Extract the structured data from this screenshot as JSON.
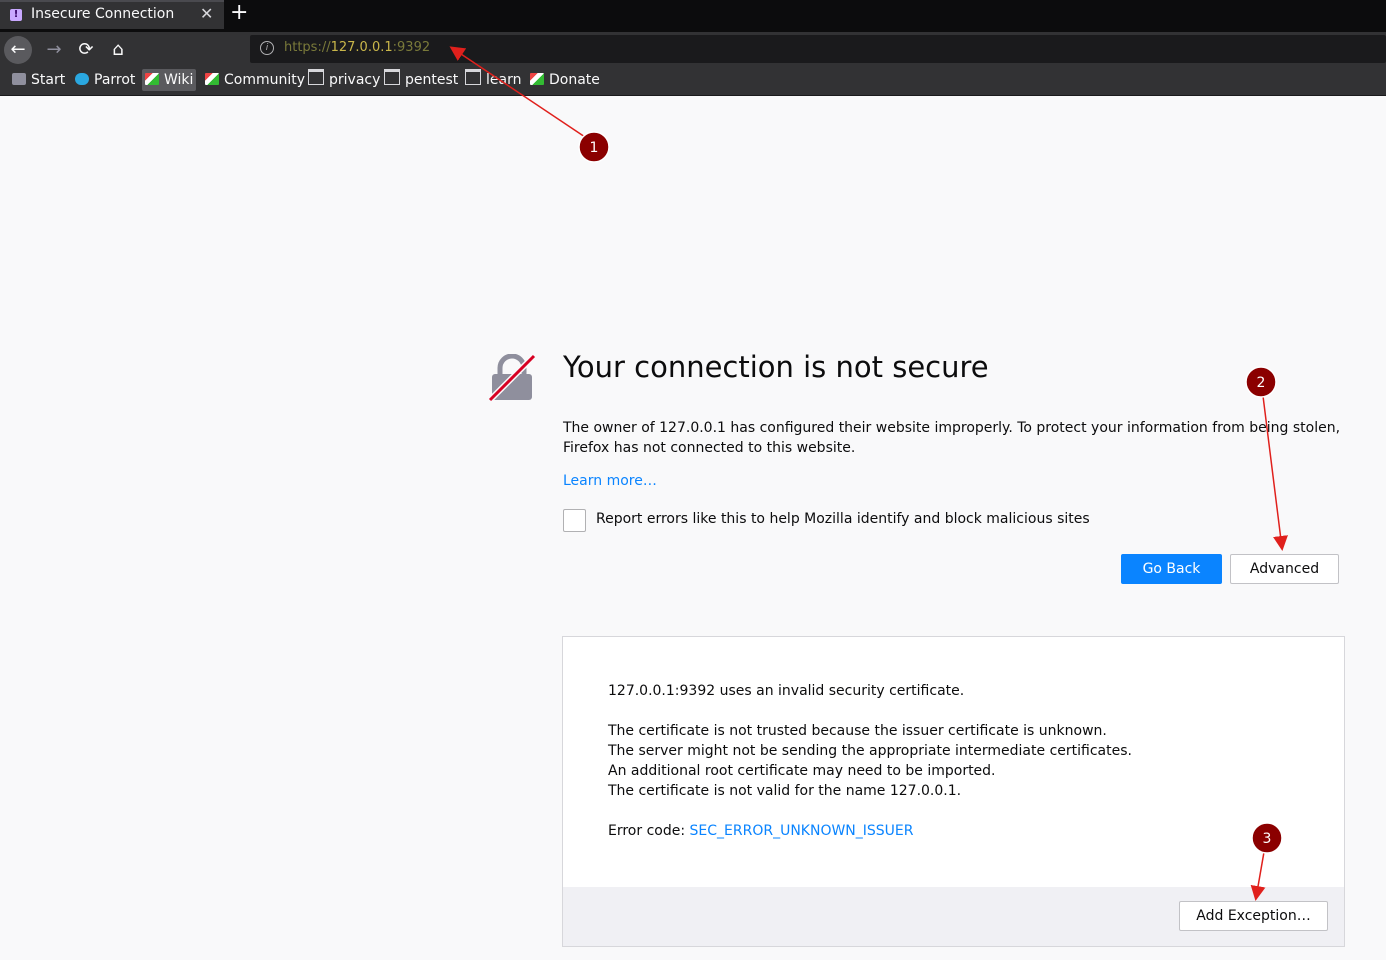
{
  "tab": {
    "title": "Insecure Connection",
    "favicon": "!",
    "close": "✕",
    "new_tab": "+"
  },
  "nav": {
    "back": "←",
    "forward": "→",
    "reload": "⟳",
    "home": "⌂"
  },
  "url": {
    "scheme": "https://",
    "host": "127.0.0.1",
    "port": ":9392",
    "info": "i"
  },
  "bookmarks": [
    "Start",
    "Parrot",
    "Wiki",
    "Community",
    "privacy",
    "pentest",
    "learn",
    "Donate"
  ],
  "page": {
    "title": "Your connection is not secure",
    "description": "The owner of 127.0.0.1 has configured their website improperly. To protect your information from being stolen, Firefox has not connected to this website.",
    "learn_more": "Learn more…",
    "report_label": "Report errors like this to help Mozilla identify and block malicious sites",
    "go_back": "Go Back",
    "advanced": "Advanced"
  },
  "advanced_panel": {
    "line1": "127.0.0.1:9392 uses an invalid security certificate.",
    "line2": "The certificate is not trusted because the issuer certificate is unknown.",
    "line3": "The server might not be sending the appropriate intermediate certificates.",
    "line4": "An additional root certificate may need to be imported.",
    "line5": "The certificate is not valid for the name 127.0.0.1.",
    "error_label": "Error code: ",
    "error_code": "SEC_ERROR_UNKNOWN_ISSUER",
    "add_exception": "Add Exception…"
  },
  "annotations": [
    "1",
    "2",
    "3"
  ],
  "colors": {
    "accent": "#0a84ff",
    "annotation": "#8b0000",
    "arrow": "#e0201c"
  }
}
